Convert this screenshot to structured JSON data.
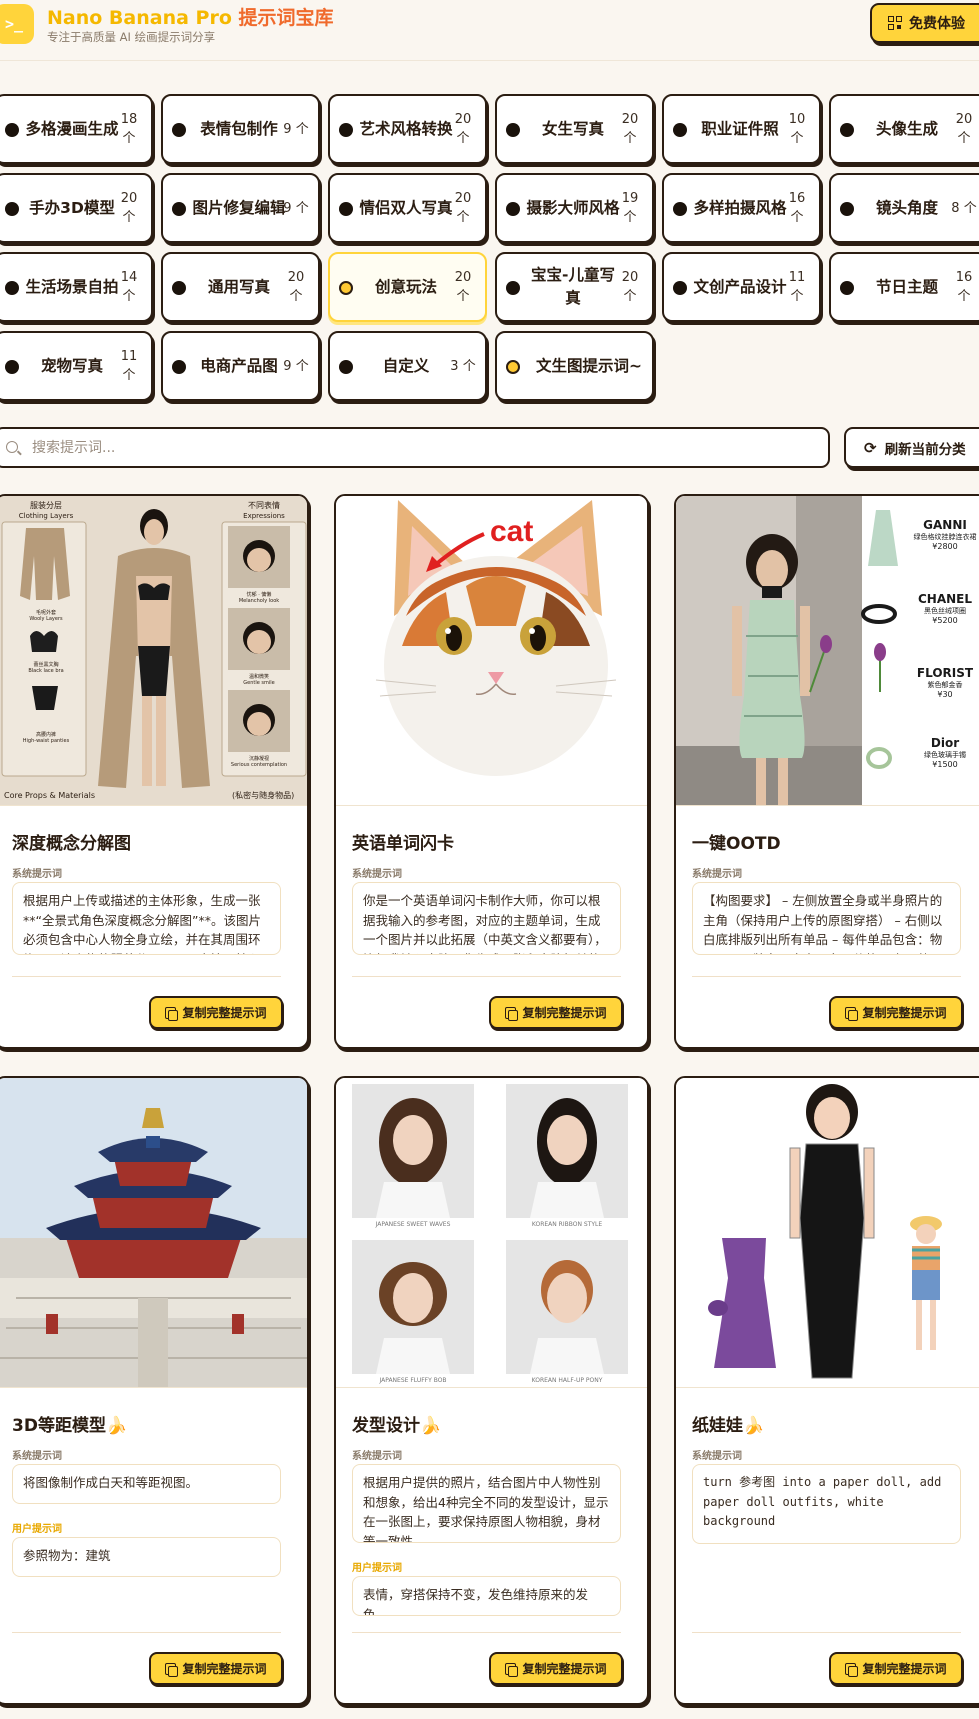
{
  "header": {
    "logo_glyph": ">_",
    "title_main": "Nano Banana Pro",
    "title_accent": "提示词宝库",
    "subtitle": "专注于高质量 AI 绘画提示词分享",
    "try_button": "免费体验"
  },
  "categories": [
    {
      "name": "多格漫画生成",
      "count": "18 个"
    },
    {
      "name": "表情包制作",
      "count": "9 个"
    },
    {
      "name": "艺术风格转换",
      "count": "20 个"
    },
    {
      "name": "女生写真",
      "count": "20 个"
    },
    {
      "name": "职业证件照",
      "count": "10 个"
    },
    {
      "name": "头像生成",
      "count": "20 个"
    },
    {
      "name": "手办3D模型",
      "count": "20 个"
    },
    {
      "name": "图片修复编辑",
      "count": "9 个"
    },
    {
      "name": "情侣双人写真",
      "count": "20 个"
    },
    {
      "name": "摄影大师风格",
      "count": "19 个"
    },
    {
      "name": "多样拍摄风格",
      "count": "16 个"
    },
    {
      "name": "镜头角度",
      "count": "8 个"
    },
    {
      "name": "生活场景自拍",
      "count": "14 个"
    },
    {
      "name": "通用写真",
      "count": "20 个"
    },
    {
      "name": "创意玩法",
      "count": "20 个",
      "active": true
    },
    {
      "name": "宝宝-儿童写真",
      "count": "20 个"
    },
    {
      "name": "文创产品设计",
      "count": "11 个"
    },
    {
      "name": "节日主题",
      "count": "16 个"
    },
    {
      "name": "宠物写真",
      "count": "11 个"
    },
    {
      "name": "电商产品图",
      "count": "9 个"
    },
    {
      "name": "自定义",
      "count": "3 个"
    },
    {
      "name": "文生图提示词~",
      "count": ""
    }
  ],
  "search": {
    "placeholder": "搜索提示词...",
    "refresh_label": "刷新当前分类"
  },
  "card_texts": {
    "system_label": "系统提示词",
    "user_label": "用户提示词",
    "copy_label": "复制完整提示词"
  },
  "cards": [
    {
      "title": "深度概念分解图",
      "system_prompt": "根据用户上传或描述的主体形象，生成一张**“全景式角色深度概念分解图”**。该图片必须包含中心人物全身立绘，并在其周围环绕展示该人物的服装分层、不同表情、核心道具、",
      "image_text": {
        "left_title": "服装分层",
        "left_title_en": "Clothing Layers",
        "right_title": "不同表情",
        "right_title_en": "Expressions",
        "layer_1": "毛呢外套",
        "layer_1_en": "Wooly Layers",
        "layer_2": "蕾丝黑文胸",
        "layer_2_en": "Black lace bra",
        "layer_3": "高腰内裤",
        "layer_3_en": "High-waist panties",
        "expr_1": "忧郁 · 慵懒",
        "expr_1_en": "Melancholy look",
        "expr_2": "温和微笑",
        "expr_2_en": "Gentle smile",
        "expr_3": "沉静凝视",
        "expr_3_en": "Serious contemplation",
        "bottom_left": "Core Props & Materials",
        "bottom_right": "(私密与随身物品)"
      }
    },
    {
      "title": "英语单词闪卡",
      "system_prompt": "你是一个英语单词闪卡制作大师，你可以根据我输入的参考图，对应的主题单词，生成一个图片并以此拓展（中英文含义都要有），比如我输入电脑，你生成一张和电脑相关的图片，并用箭",
      "image_text": {
        "word": "cat"
      }
    },
    {
      "title": "一键OOTD",
      "system_prompt": "【构图要求】 – 左侧放置全身或半身照片的主角（保持用户上传的原图穿搭） – 右侧以白底排版列出所有单品 – 每件单品包含：物品图、品牌名、中文品名、价格 – 布局整",
      "image_text": {
        "items": [
          {
            "brand": "GANNI",
            "desc": "绿色格纹挂脖连衣裙",
            "price": "¥2800"
          },
          {
            "brand": "CHANEL",
            "desc": "黑色丝绒项圈",
            "price": "¥5200"
          },
          {
            "brand": "FLORIST",
            "desc": "紫色郁金香",
            "price": "¥30"
          },
          {
            "brand": "Dior",
            "desc": "绿色玻璃手镯",
            "price": "¥1500"
          }
        ]
      }
    },
    {
      "title": "3D等距模型🍌",
      "system_prompt": "将图像制作成白天和等距视图。",
      "user_prompt": "参照物为：建筑"
    },
    {
      "title": "发型设计🍌",
      "system_prompt": "根据用户提供的照片，结合图片中人物性别和想象，给出4种完全不同的发型设计，显示在一张图上，要求保持原图人物相貌，身材等一致性",
      "user_prompt": "表情，穿搭保持不变，发色维持原来的发色。",
      "image_text": {
        "captions": [
          "JAPANESE SWEET WAVES",
          "KOREAN RIBBON STYLE",
          "JAPANESE FLUFFY BOB",
          "KOREAN HALF-UP PONY"
        ]
      }
    },
    {
      "title": "纸娃娃🍌",
      "system_prompt": "turn 参考图 into a paper doll, add paper doll outfits, white background"
    }
  ],
  "colors": {
    "accent_yellow": "#ffd43b",
    "title_orange": "#f06a2c",
    "ink": "#2b1d12",
    "background": "#faf6f0"
  }
}
